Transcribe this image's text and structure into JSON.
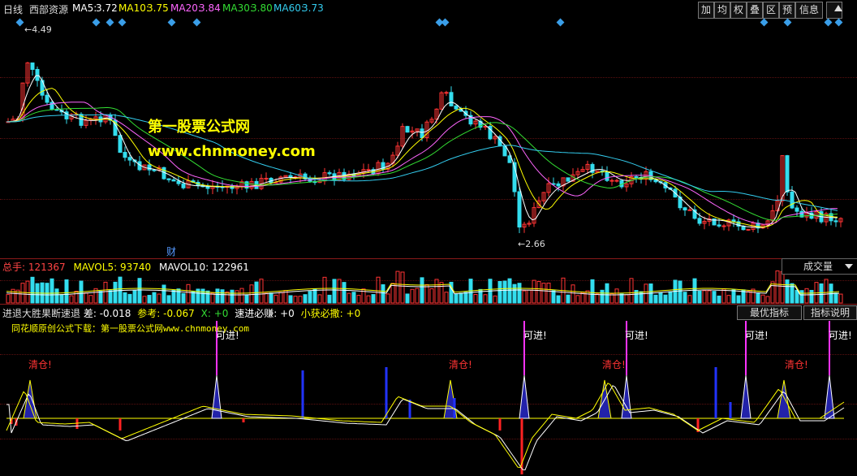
{
  "topbar": {
    "period": "日线",
    "stock_name": "西部资源",
    "ma5_label": "MA5:",
    "ma5_value": "3.72",
    "ma10_label": "MA10:",
    "ma10_value": "3.75",
    "ma20_label": "MA20:",
    "ma20_value": "3.84",
    "ma30_label": "MA30:",
    "ma30_value": "3.80",
    "ma60_label": "MA60:",
    "ma60_value": "3.73",
    "buttons": [
      "加",
      "均",
      "权",
      "叠",
      "区",
      "预",
      "信息"
    ],
    "expand_icon": "triangle-up-icon"
  },
  "price_panel": {
    "high_label": "4.49",
    "low_label": "2.66",
    "watermark_line1": "第一股票公式网",
    "watermark_line2": "www.chnmoney.com",
    "finance_marker": "财"
  },
  "volume_panel": {
    "total_label": "总手:",
    "total_value": "121367",
    "mavol5_label": "MAVOL5:",
    "mavol5_value": "93740",
    "mavol10_label": "MAVOL10:",
    "mavol10_value": "122961",
    "dropdown_label": "成交量"
  },
  "indicator_panel": {
    "name": "进退大胜果断速退",
    "diff_label": "差:",
    "diff_value": "-0.018",
    "ref_label": "参考:",
    "ref_value": "-0.067",
    "x_label": "X:",
    "x_value": "+0",
    "sell_label": "速进必赚:",
    "sell_value": "+0",
    "small_label": "小获必撒:",
    "small_value": "+0",
    "best_button": "最优指标",
    "explain_button": "指标说明",
    "source_text": "同花顺原创公式下载：第一股票公式网www.chnmoney.com",
    "signal_enter": "可进!",
    "signal_clear": "清仓!"
  },
  "colors": {
    "ma5": "#ffffff",
    "ma10": "#ffff00",
    "ma20": "#ff66ff",
    "ma30": "#33dd33",
    "ma60": "#33ccee",
    "up": "#ff3333",
    "down": "#33ddee",
    "grid": "#8b1a1a"
  }
}
